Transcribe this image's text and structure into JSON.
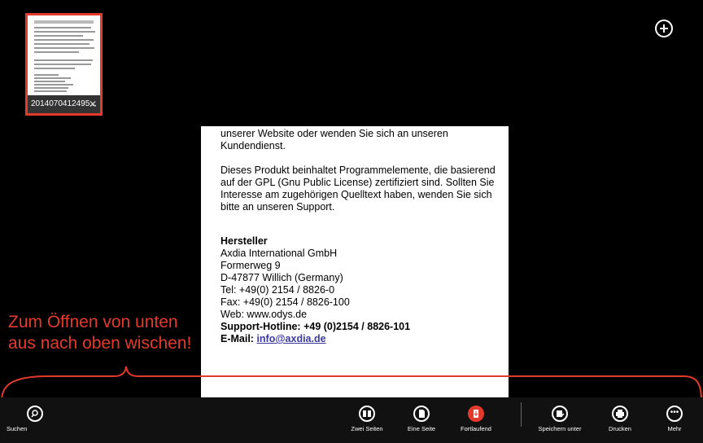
{
  "tab": {
    "label": "2014070412495...",
    "close_icon": "close-icon"
  },
  "add_button": {
    "icon": "plus-icon"
  },
  "document": {
    "para1": "unserer Website oder wenden Sie sich an unseren Kundendienst.",
    "para2": "Dieses Produkt beinhaltet Programmelemente, die basierend auf der GPL (Gnu Public License) zertifiziert sind. Sollten Sie Interesse am zugehörigen Quelltext haben, wenden Sie sich bitte an unseren Support.",
    "heading": "Hersteller",
    "company": "Axdia International GmbH",
    "street": "Formerweg 9",
    "city": "D-47877 Willich (Germany)",
    "tel": "Tel: +49(0) 2154 / 8826-0",
    "fax": "Fax: +49(0) 2154 / 8826-100",
    "web": "Web: www.odys.de",
    "hotline": "Support-Hotline: +49 (0)2154 / 8826-101",
    "email_label": "E-Mail: ",
    "email": "info@axdia.de"
  },
  "overlay": {
    "line1": "Zum Öffnen von unten",
    "line2": "aus nach oben wischen!",
    "color": "#e23b2e"
  },
  "appbar": {
    "search": "Suchen",
    "two_pages": "Zwei Seiten",
    "one_page": "Eine Seite",
    "continuous": "Fortlaufend",
    "save_as": "Speichern unter",
    "print": "Drucken",
    "more": "Mehr"
  }
}
